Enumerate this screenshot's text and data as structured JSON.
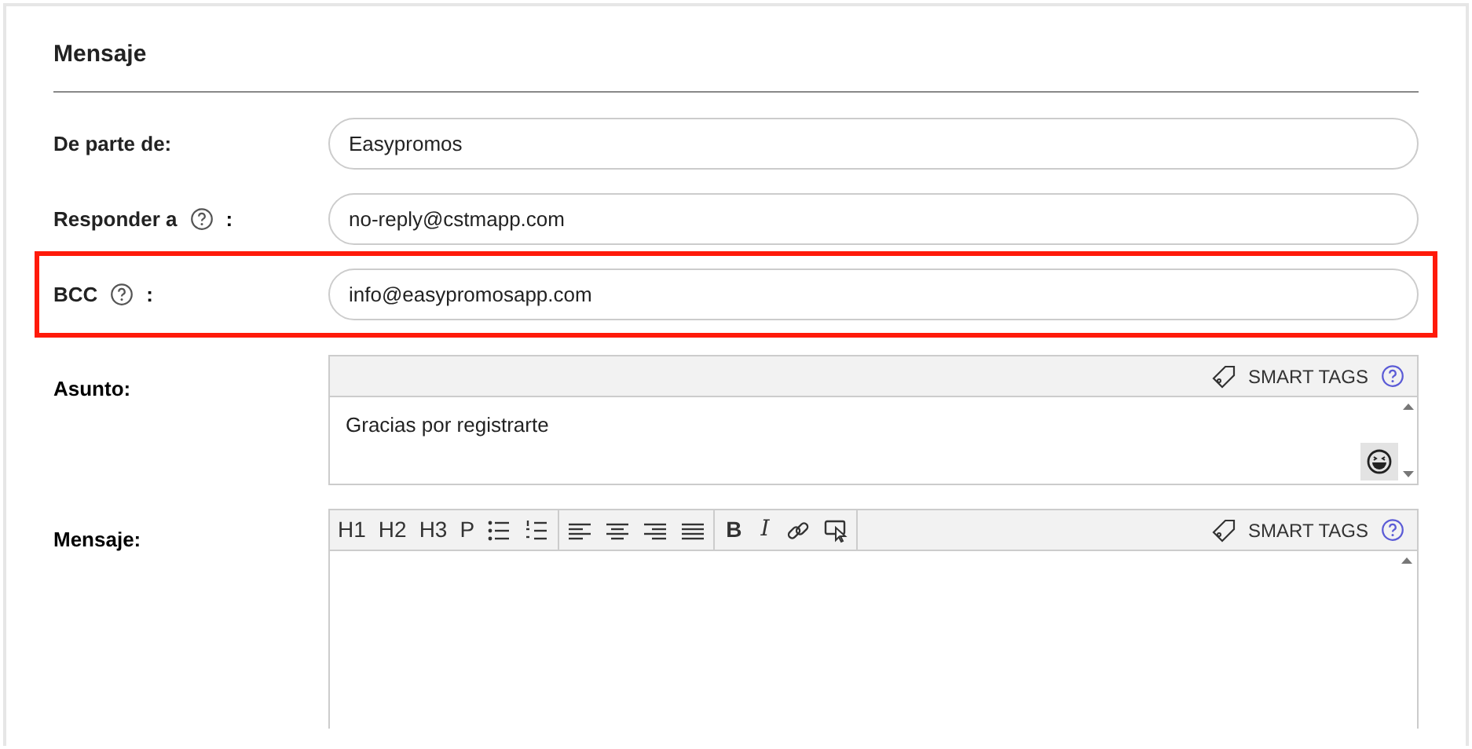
{
  "section_title": "Mensaje",
  "fields": [
    {
      "label": "De parte de:",
      "help": false,
      "value": "Easypromos",
      "highlighted": false
    },
    {
      "label": "Responder a",
      "help": true,
      "suffix": ":",
      "value": "no-reply@cstmapp.com",
      "highlighted": false
    },
    {
      "label": "BCC",
      "help": true,
      "suffix": ":",
      "value": "info@easypromosapp.com",
      "highlighted": true
    }
  ],
  "subject": {
    "label": "Asunto:",
    "smart_tags": "SMART TAGS",
    "value": "Gracias por registrarte"
  },
  "message": {
    "label": "Mensaje:",
    "smart_tags": "SMART TAGS",
    "toolbar": [
      [
        {
          "kind": "text",
          "label": "H1"
        },
        {
          "kind": "text",
          "label": "H2"
        },
        {
          "kind": "text",
          "label": "H3"
        },
        {
          "kind": "text",
          "label": "P"
        },
        {
          "kind": "bullets"
        },
        {
          "kind": "numbers"
        }
      ],
      [
        {
          "kind": "align-left"
        },
        {
          "kind": "align-center"
        },
        {
          "kind": "align-right"
        },
        {
          "kind": "justify"
        }
      ],
      [
        {
          "kind": "bold",
          "label": "B"
        },
        {
          "kind": "italic",
          "label": "I"
        },
        {
          "kind": "link"
        },
        {
          "kind": "pointer"
        }
      ]
    ]
  }
}
